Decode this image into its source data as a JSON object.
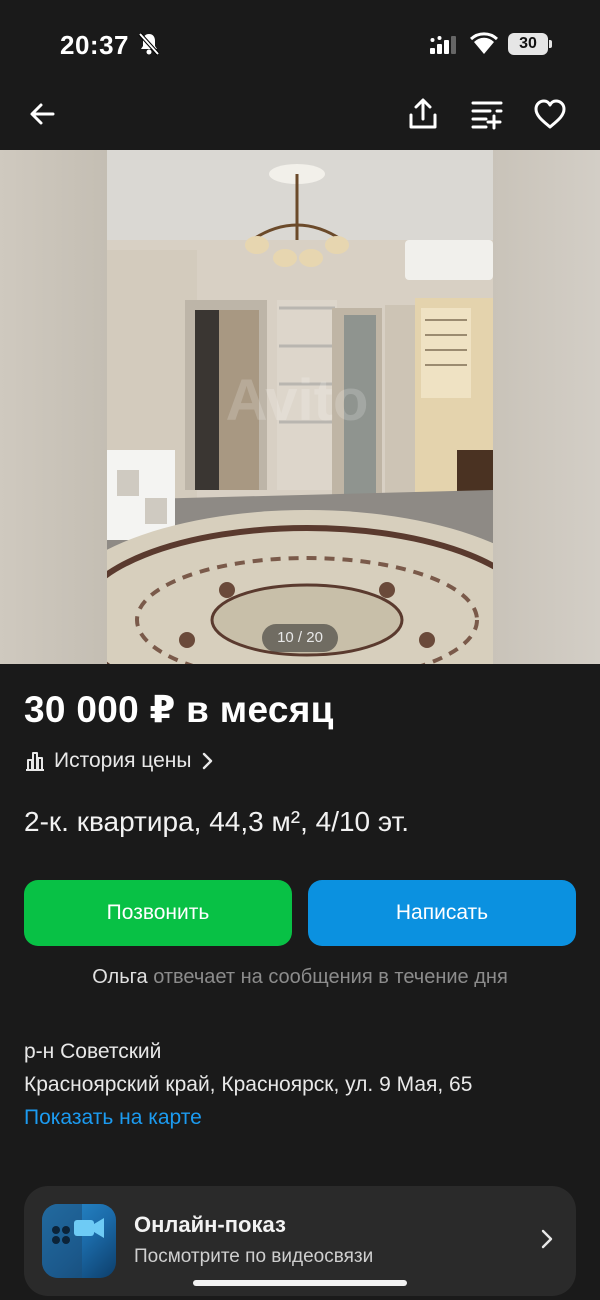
{
  "status_bar": {
    "time": "20:37",
    "battery": "30"
  },
  "nav": {
    "icons": [
      "back-arrow-icon",
      "share-icon",
      "compare-icon",
      "favorite-heart-icon"
    ]
  },
  "gallery": {
    "counter": "10 / 20",
    "watermark": "Avito"
  },
  "listing": {
    "price": "30 000 ₽ в месяц",
    "price_history": "История цены",
    "title": "2-к. квартира, 44,3 м², 4/10 эт."
  },
  "actions": {
    "call": "Позвонить",
    "write": "Написать"
  },
  "seller": {
    "name": "Ольга",
    "responds": "отвечает на сообщения в течение дня"
  },
  "location": {
    "district": "р-н Советский",
    "address": "Красноярский край, Красноярск, ул. 9 Мая, 65",
    "map_link": "Показать на карте"
  },
  "online_view": {
    "title": "Онлайн-показ",
    "subtitle": "Посмотрите по видеосвязи"
  },
  "colors": {
    "background": "#1a1a1a",
    "call_button": "#08c145",
    "write_button": "#0b91e0",
    "link": "#1c9bf0"
  }
}
